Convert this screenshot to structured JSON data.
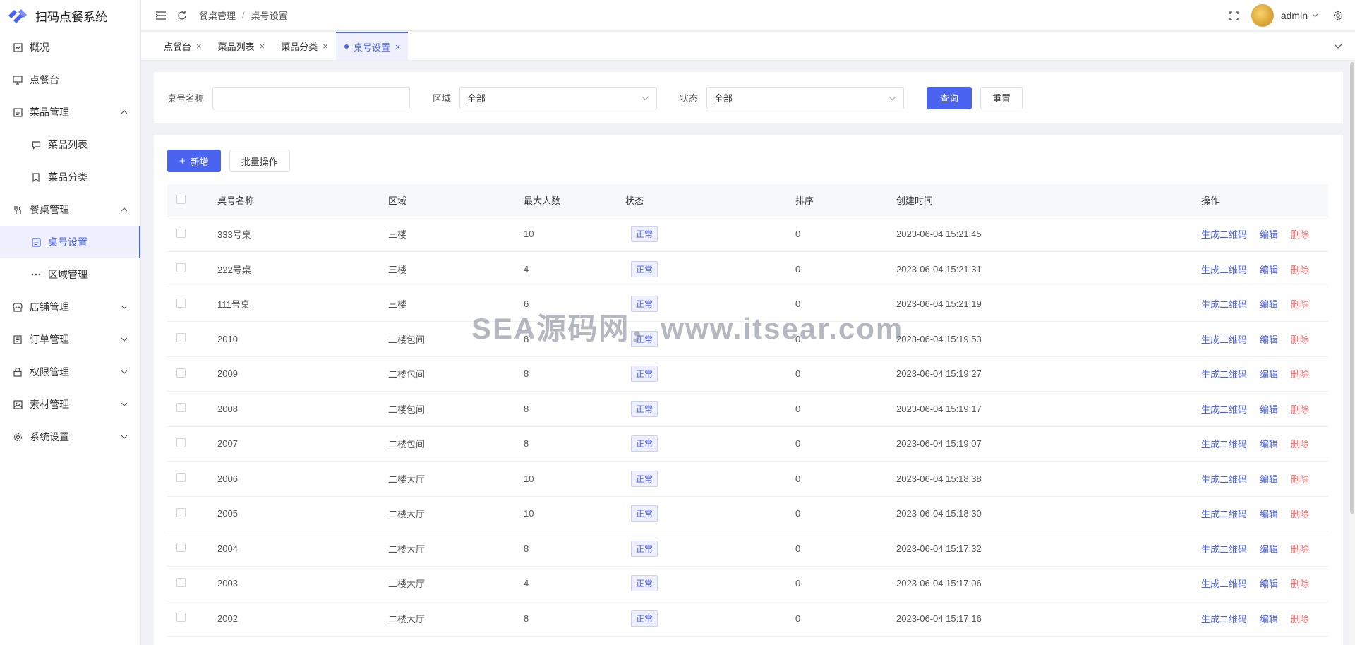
{
  "app": {
    "title": "扫码点餐系统"
  },
  "sidebar": {
    "items": [
      {
        "label": "概况",
        "icon": "dashboard-icon"
      },
      {
        "label": "点餐台",
        "icon": "monitor-icon"
      },
      {
        "label": "菜品管理",
        "icon": "list-icon",
        "expanded": true
      },
      {
        "label": "菜品列表",
        "icon": "chat-icon"
      },
      {
        "label": "菜品分类",
        "icon": "bookmark-icon"
      },
      {
        "label": "餐桌管理",
        "icon": "fork-knife-icon",
        "expanded": true
      },
      {
        "label": "桌号设置",
        "icon": "table-icon",
        "active": true
      },
      {
        "label": "区域管理",
        "icon": "more-dots-icon"
      },
      {
        "label": "店铺管理",
        "icon": "shop-icon"
      },
      {
        "label": "订单管理",
        "icon": "order-icon"
      },
      {
        "label": "权限管理",
        "icon": "lock-icon"
      },
      {
        "label": "素材管理",
        "icon": "image-icon"
      },
      {
        "label": "系统设置",
        "icon": "gear-icon"
      }
    ]
  },
  "header": {
    "breadcrumb": [
      "餐桌管理",
      "桌号设置"
    ],
    "separator": "/",
    "user": "admin"
  },
  "tabs": [
    {
      "label": "点餐台"
    },
    {
      "label": "菜品列表"
    },
    {
      "label": "菜品分类"
    },
    {
      "label": "桌号设置",
      "active": true
    }
  ],
  "filter": {
    "name_label": "桌号名称",
    "name_value": "",
    "area_label": "区域",
    "area_value": "全部",
    "status_label": "状态",
    "status_value": "全部",
    "query_button": "查询",
    "reset_button": "重置"
  },
  "toolbar": {
    "add_button": "新增",
    "batch_button": "批量操作"
  },
  "table": {
    "columns": [
      "桌号名称",
      "区域",
      "最大人数",
      "状态",
      "排序",
      "创建时间",
      "操作"
    ],
    "rows": [
      {
        "name": "333号桌",
        "area": "三楼",
        "max": "10",
        "status": "正常",
        "sort": "0",
        "created": "2023-06-04 15:21:45"
      },
      {
        "name": "222号桌",
        "area": "三楼",
        "max": "4",
        "status": "正常",
        "sort": "0",
        "created": "2023-06-04 15:21:31"
      },
      {
        "name": "111号桌",
        "area": "三楼",
        "max": "6",
        "status": "正常",
        "sort": "0",
        "created": "2023-06-04 15:21:19"
      },
      {
        "name": "2010",
        "area": "二楼包间",
        "max": "8",
        "status": "正常",
        "sort": "0",
        "created": "2023-06-04 15:19:53"
      },
      {
        "name": "2009",
        "area": "二楼包间",
        "max": "8",
        "status": "正常",
        "sort": "0",
        "created": "2023-06-04 15:19:27"
      },
      {
        "name": "2008",
        "area": "二楼包间",
        "max": "8",
        "status": "正常",
        "sort": "0",
        "created": "2023-06-04 15:19:17"
      },
      {
        "name": "2007",
        "area": "二楼包间",
        "max": "8",
        "status": "正常",
        "sort": "0",
        "created": "2023-06-04 15:19:07"
      },
      {
        "name": "2006",
        "area": "二楼大厅",
        "max": "10",
        "status": "正常",
        "sort": "0",
        "created": "2023-06-04 15:18:38"
      },
      {
        "name": "2005",
        "area": "二楼大厅",
        "max": "10",
        "status": "正常",
        "sort": "0",
        "created": "2023-06-04 15:18:30"
      },
      {
        "name": "2004",
        "area": "二楼大厅",
        "max": "8",
        "status": "正常",
        "sort": "0",
        "created": "2023-06-04 15:17:32"
      },
      {
        "name": "2003",
        "area": "二楼大厅",
        "max": "4",
        "status": "正常",
        "sort": "0",
        "created": "2023-06-04 15:17:06"
      },
      {
        "name": "2002",
        "area": "二楼大厅",
        "max": "8",
        "status": "正常",
        "sort": "0",
        "created": "2023-06-04 15:17:16"
      }
    ],
    "actions": {
      "qrcode": "生成二维码",
      "edit": "编辑",
      "delete": "删除"
    }
  },
  "watermark": "SEA源码网，www.itsear.com",
  "colors": {
    "accent": "#4b63f1",
    "danger": "#f56c6c"
  }
}
